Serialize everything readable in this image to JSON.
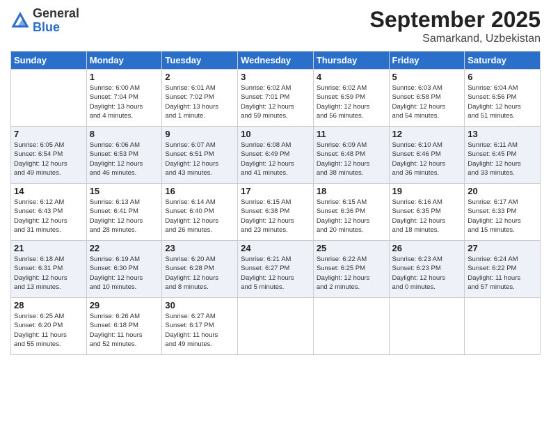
{
  "logo": {
    "general": "General",
    "blue": "Blue"
  },
  "header": {
    "month": "September 2025",
    "location": "Samarkand, Uzbekistan"
  },
  "days": [
    "Sunday",
    "Monday",
    "Tuesday",
    "Wednesday",
    "Thursday",
    "Friday",
    "Saturday"
  ],
  "weeks": [
    [
      {
        "date": "",
        "info": ""
      },
      {
        "date": "1",
        "info": "Sunrise: 6:00 AM\nSunset: 7:04 PM\nDaylight: 13 hours\nand 4 minutes."
      },
      {
        "date": "2",
        "info": "Sunrise: 6:01 AM\nSunset: 7:02 PM\nDaylight: 13 hours\nand 1 minute."
      },
      {
        "date": "3",
        "info": "Sunrise: 6:02 AM\nSunset: 7:01 PM\nDaylight: 12 hours\nand 59 minutes."
      },
      {
        "date": "4",
        "info": "Sunrise: 6:02 AM\nSunset: 6:59 PM\nDaylight: 12 hours\nand 56 minutes."
      },
      {
        "date": "5",
        "info": "Sunrise: 6:03 AM\nSunset: 6:58 PM\nDaylight: 12 hours\nand 54 minutes."
      },
      {
        "date": "6",
        "info": "Sunrise: 6:04 AM\nSunset: 6:56 PM\nDaylight: 12 hours\nand 51 minutes."
      }
    ],
    [
      {
        "date": "7",
        "info": "Sunrise: 6:05 AM\nSunset: 6:54 PM\nDaylight: 12 hours\nand 49 minutes."
      },
      {
        "date": "8",
        "info": "Sunrise: 6:06 AM\nSunset: 6:53 PM\nDaylight: 12 hours\nand 46 minutes."
      },
      {
        "date": "9",
        "info": "Sunrise: 6:07 AM\nSunset: 6:51 PM\nDaylight: 12 hours\nand 43 minutes."
      },
      {
        "date": "10",
        "info": "Sunrise: 6:08 AM\nSunset: 6:49 PM\nDaylight: 12 hours\nand 41 minutes."
      },
      {
        "date": "11",
        "info": "Sunrise: 6:09 AM\nSunset: 6:48 PM\nDaylight: 12 hours\nand 38 minutes."
      },
      {
        "date": "12",
        "info": "Sunrise: 6:10 AM\nSunset: 6:46 PM\nDaylight: 12 hours\nand 36 minutes."
      },
      {
        "date": "13",
        "info": "Sunrise: 6:11 AM\nSunset: 6:45 PM\nDaylight: 12 hours\nand 33 minutes."
      }
    ],
    [
      {
        "date": "14",
        "info": "Sunrise: 6:12 AM\nSunset: 6:43 PM\nDaylight: 12 hours\nand 31 minutes."
      },
      {
        "date": "15",
        "info": "Sunrise: 6:13 AM\nSunset: 6:41 PM\nDaylight: 12 hours\nand 28 minutes."
      },
      {
        "date": "16",
        "info": "Sunrise: 6:14 AM\nSunset: 6:40 PM\nDaylight: 12 hours\nand 26 minutes."
      },
      {
        "date": "17",
        "info": "Sunrise: 6:15 AM\nSunset: 6:38 PM\nDaylight: 12 hours\nand 23 minutes."
      },
      {
        "date": "18",
        "info": "Sunrise: 6:15 AM\nSunset: 6:36 PM\nDaylight: 12 hours\nand 20 minutes."
      },
      {
        "date": "19",
        "info": "Sunrise: 6:16 AM\nSunset: 6:35 PM\nDaylight: 12 hours\nand 18 minutes."
      },
      {
        "date": "20",
        "info": "Sunrise: 6:17 AM\nSunset: 6:33 PM\nDaylight: 12 hours\nand 15 minutes."
      }
    ],
    [
      {
        "date": "21",
        "info": "Sunrise: 6:18 AM\nSunset: 6:31 PM\nDaylight: 12 hours\nand 13 minutes."
      },
      {
        "date": "22",
        "info": "Sunrise: 6:19 AM\nSunset: 6:30 PM\nDaylight: 12 hours\nand 10 minutes."
      },
      {
        "date": "23",
        "info": "Sunrise: 6:20 AM\nSunset: 6:28 PM\nDaylight: 12 hours\nand 8 minutes."
      },
      {
        "date": "24",
        "info": "Sunrise: 6:21 AM\nSunset: 6:27 PM\nDaylight: 12 hours\nand 5 minutes."
      },
      {
        "date": "25",
        "info": "Sunrise: 6:22 AM\nSunset: 6:25 PM\nDaylight: 12 hours\nand 2 minutes."
      },
      {
        "date": "26",
        "info": "Sunrise: 6:23 AM\nSunset: 6:23 PM\nDaylight: 12 hours\nand 0 minutes."
      },
      {
        "date": "27",
        "info": "Sunrise: 6:24 AM\nSunset: 6:22 PM\nDaylight: 11 hours\nand 57 minutes."
      }
    ],
    [
      {
        "date": "28",
        "info": "Sunrise: 6:25 AM\nSunset: 6:20 PM\nDaylight: 11 hours\nand 55 minutes."
      },
      {
        "date": "29",
        "info": "Sunrise: 6:26 AM\nSunset: 6:18 PM\nDaylight: 11 hours\nand 52 minutes."
      },
      {
        "date": "30",
        "info": "Sunrise: 6:27 AM\nSunset: 6:17 PM\nDaylight: 11 hours\nand 49 minutes."
      },
      {
        "date": "",
        "info": ""
      },
      {
        "date": "",
        "info": ""
      },
      {
        "date": "",
        "info": ""
      },
      {
        "date": "",
        "info": ""
      }
    ]
  ]
}
